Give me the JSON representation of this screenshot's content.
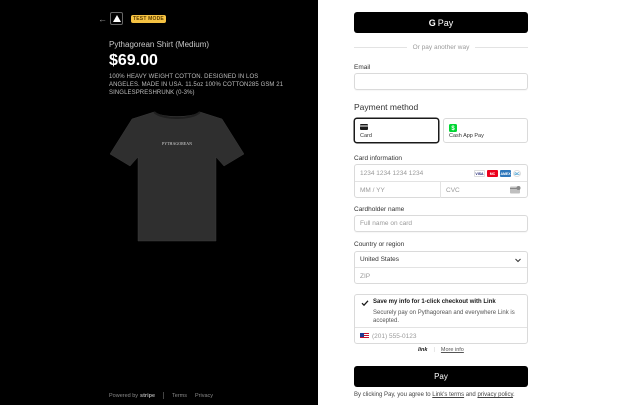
{
  "header": {
    "back_glyph": "←",
    "test_mode": "TEST MODE"
  },
  "product": {
    "name": "Pythagorean Shirt (Medium)",
    "price": "$69.00",
    "description": "100% HEAVY WEIGHT COTTON. DESIGNED IN LOS ANGELES. MADE IN USA. 11.5oz 100% COTTON285 GSM 21 SINGLESPRESHRUNK (0-3%)",
    "shirt_text": "PYTHAGOREAN"
  },
  "footer": {
    "powered_by": "Powered by",
    "stripe": "stripe",
    "terms": "Terms",
    "privacy": "Privacy"
  },
  "wallet": {
    "gpay_g": "G",
    "gpay_label": "Pay",
    "or_text": "Or pay another way"
  },
  "email": {
    "label": "Email",
    "value": ""
  },
  "payment_method": {
    "title": "Payment method",
    "options": [
      {
        "label": "Card",
        "selected": true,
        "icon": "card-icon"
      },
      {
        "label": "Cash App Pay",
        "selected": false,
        "icon": "cash-app-icon"
      }
    ]
  },
  "card": {
    "label": "Card information",
    "number_placeholder": "1234 1234 1234 1234",
    "expiry_placeholder": "MM / YY",
    "cvc_placeholder": "CVC",
    "brands": [
      {
        "name": "VISA",
        "color": "#1a1f71",
        "bg": "#ffffff"
      },
      {
        "name": "MC",
        "color": "#ffffff",
        "bg": "#eb001b"
      },
      {
        "name": "AMEX",
        "color": "#ffffff",
        "bg": "#2e77bb"
      },
      {
        "name": "DC",
        "color": "#0079be",
        "bg": "#ffffff"
      }
    ]
  },
  "cardholder": {
    "label": "Cardholder name",
    "placeholder": "Full name on card"
  },
  "country": {
    "label": "Country or region",
    "selected": "United States",
    "zip_placeholder": "ZIP"
  },
  "link": {
    "title": "Save my info for 1-click checkout with Link",
    "subtitle": "Securely pay on Pythagorean and everywhere Link is accepted.",
    "checked": true,
    "phone_placeholder": "(201) 555-0123",
    "brand": "link",
    "more_info": "More info"
  },
  "pay": {
    "label": "Pay"
  },
  "terms": {
    "prefix": "By clicking Pay, you agree to ",
    "link_terms": "Link's terms",
    "and": " and ",
    "privacy": "privacy policy",
    "suffix": "."
  },
  "colors": {
    "left_bg": "#000000",
    "test_mode_bg": "#f5c242",
    "button_bg": "#000000"
  }
}
